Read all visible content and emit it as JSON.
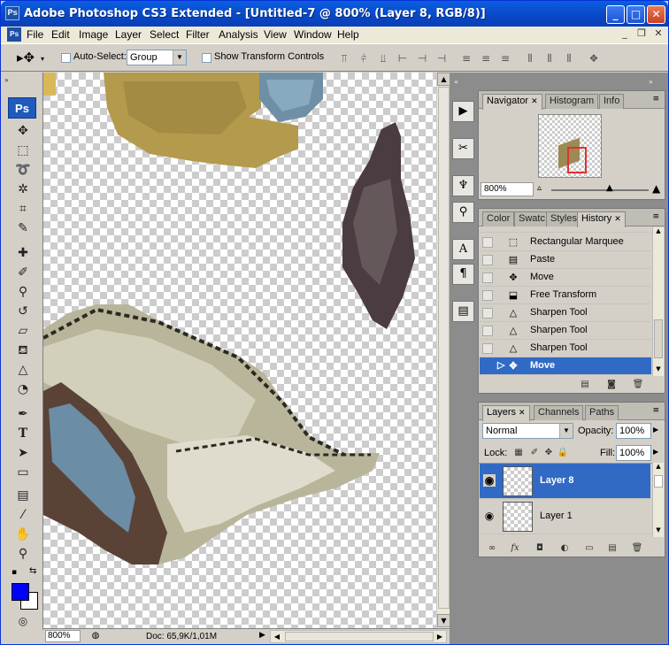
{
  "window": {
    "title": "Adobe Photoshop CS3 Extended - [Untitled-7 @ 800% (Layer 8, RGB/8)]",
    "minimize_label": "_",
    "maximize_label": "□",
    "close_label": "✕",
    "app_badge": "Ps"
  },
  "menubar": {
    "items": [
      "File",
      "Edit",
      "Image",
      "Layer",
      "Select",
      "Filter",
      "Analysis",
      "View",
      "Window",
      "Help"
    ],
    "mdi_buttons": [
      "_",
      "❐",
      "✕"
    ]
  },
  "options": {
    "auto_select_label": "Auto-Select:",
    "auto_select_value": "Group",
    "show_transform_label": "Show Transform Controls"
  },
  "toolbox": {
    "logo": "Ps",
    "foreground_color": "#0000ff",
    "background_color": "#ffffff"
  },
  "status": {
    "zoom": "800%",
    "doc": "Doc: 65,9K/1,01M"
  },
  "navigator": {
    "tabs": [
      "Navigator",
      "Histogram",
      "Info"
    ],
    "zoom": "800%"
  },
  "history": {
    "tabs": [
      "Color",
      "Swatc",
      "Styles",
      "History"
    ],
    "items": [
      {
        "label": "Rectangular Marquee",
        "icon": "marquee-icon",
        "selected": false
      },
      {
        "label": "Paste",
        "icon": "paste-icon",
        "selected": false
      },
      {
        "label": "Move",
        "icon": "move-icon",
        "selected": false
      },
      {
        "label": "Free Transform",
        "icon": "transform-icon",
        "selected": false
      },
      {
        "label": "Sharpen Tool",
        "icon": "sharpen-icon",
        "selected": false
      },
      {
        "label": "Sharpen Tool",
        "icon": "sharpen-icon",
        "selected": false
      },
      {
        "label": "Sharpen Tool",
        "icon": "sharpen-icon",
        "selected": false
      },
      {
        "label": "Move",
        "icon": "move-icon",
        "selected": true
      }
    ]
  },
  "layers": {
    "tabs": [
      "Layers",
      "Channels",
      "Paths"
    ],
    "blend_mode": "Normal",
    "opacity_label": "Opacity:",
    "opacity": "100%",
    "lock_label": "Lock:",
    "fill_label": "Fill:",
    "fill": "100%",
    "items": [
      {
        "name": "Layer 8",
        "selected": true
      },
      {
        "name": "Layer 1",
        "selected": false
      }
    ]
  },
  "colors": {
    "selection": "#316ac5",
    "titlebar": "#0a5fe0"
  }
}
